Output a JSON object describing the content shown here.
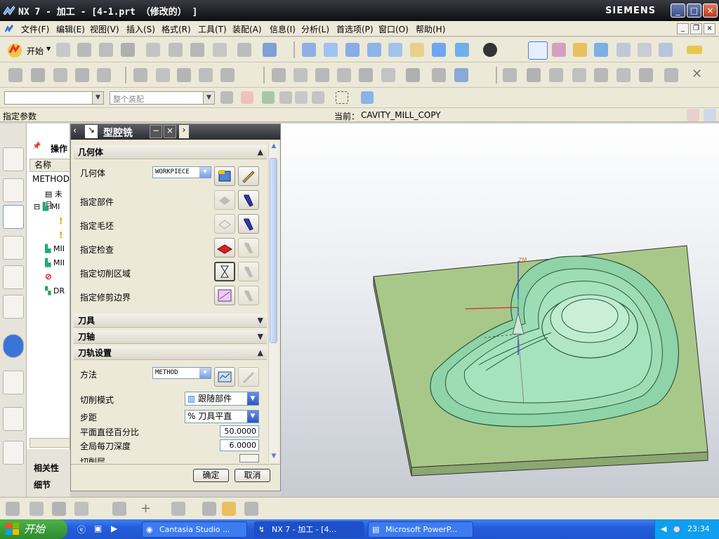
{
  "window": {
    "title": "NX 7 - 加工 - [4-1.prt （修改的） ]",
    "brand": "SIEMENS",
    "controls": [
      "_",
      "□",
      "×"
    ]
  },
  "menu": {
    "items": [
      "文件(F)",
      "编辑(E)",
      "视图(V)",
      "插入(S)",
      "格式(R)",
      "工具(T)",
      "装配(A)",
      "信息(I)",
      "分析(L)",
      "首选项(P)",
      "窗口(O)",
      "帮助(H)"
    ]
  },
  "toolbar": {
    "start_label": "开始",
    "assembly_placeholder": "整个装配"
  },
  "cue": {
    "prompt": "指定参数",
    "current_label": "当前：",
    "current_value": "CAVITY_MILL_COPY"
  },
  "nav": {
    "title": "操作",
    "column_name": "名称",
    "root": "METHOD",
    "items": [
      "未月",
      "MI",
      "",
      "",
      "MII",
      "MII",
      "",
      "DR"
    ],
    "footer_items": [
      "相关性",
      "细节"
    ]
  },
  "dialog": {
    "title": "型腔铣",
    "sections": {
      "geometry": "几何体",
      "tool": "刀具",
      "axis": "刀轴",
      "path": "刀轨设置"
    },
    "geometry": {
      "geometry_label": "几何体",
      "geometry_value": "WORKPIECE",
      "part_label": "指定部件",
      "blank_label": "指定毛坯",
      "check_label": "指定检查",
      "cut_area_label": "指定切削区域",
      "trim_label": "指定修剪边界"
    },
    "path": {
      "method_label": "方法",
      "method_value": "METHOD",
      "cut_mode_label": "切削模式",
      "cut_mode_value": "跟随部件",
      "stepover_label": "步距",
      "stepover_value": "% 刀具平直",
      "percent_label": "平面直径百分比",
      "percent_value": "50.0000",
      "depth_label": "全局每刀深度",
      "depth_value": "6.0000",
      "cut_layer_label": "切削层"
    },
    "ok": "确定",
    "cancel": "取消"
  },
  "taskbar": {
    "start": "开始",
    "tasks": [
      "Cantasia Studio ...",
      "NX 7 - 加工 - [4...",
      "Microsoft PowerP..."
    ],
    "time": "23:34"
  },
  "colors": {
    "part_green": "#8fd3a8",
    "plate_green": "#a8c88a",
    "titlebar": "#1b1b22"
  }
}
